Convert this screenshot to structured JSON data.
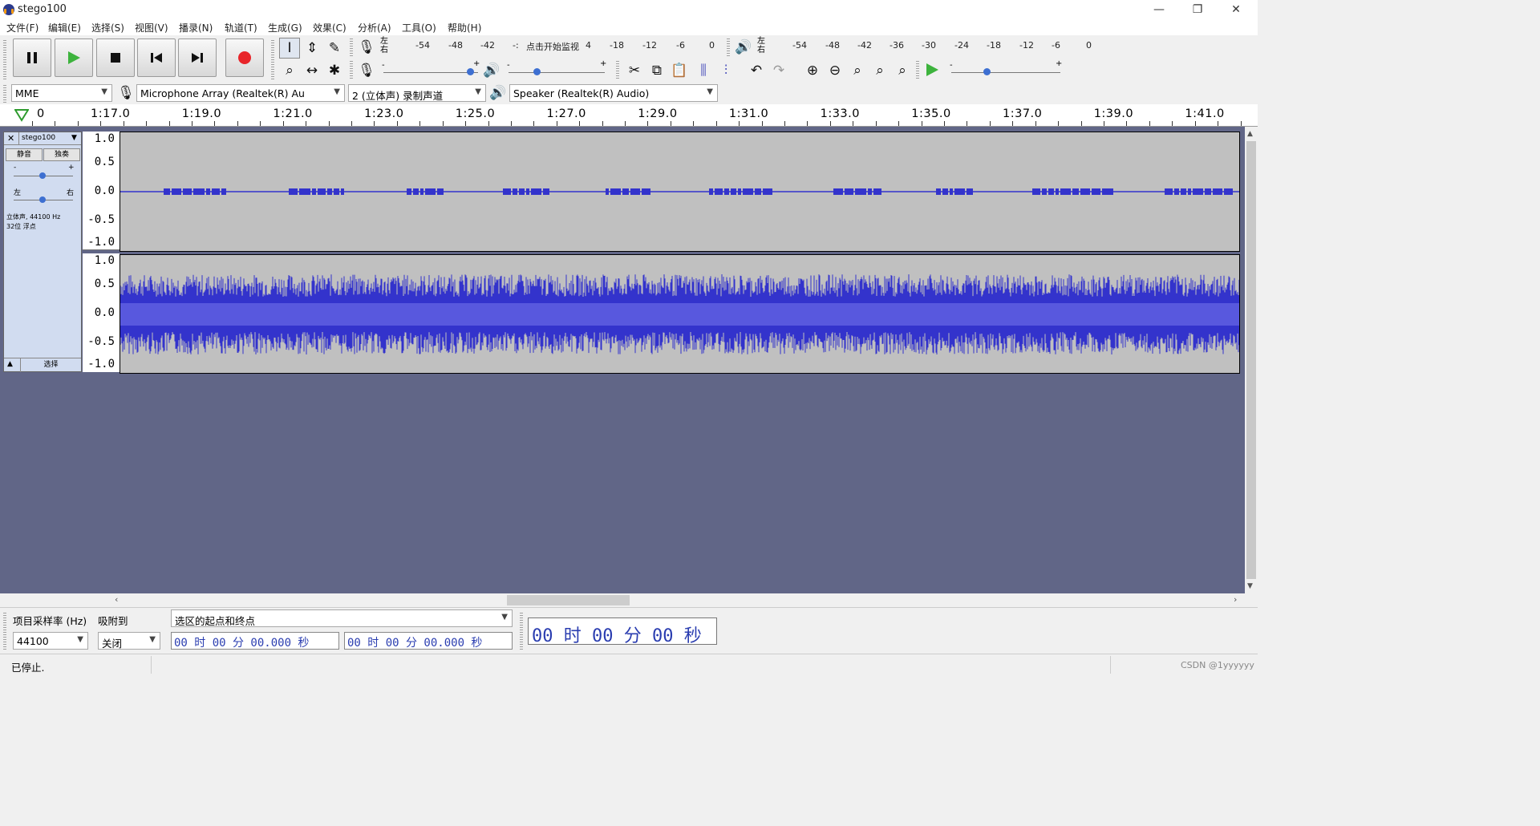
{
  "window": {
    "title": "stego100",
    "minimize": "—",
    "restore": "❐",
    "close": "✕"
  },
  "menu": [
    "文件(F)",
    "编辑(E)",
    "选择(S)",
    "视图(V)",
    "播录(N)",
    "轨道(T)",
    "生成(G)",
    "效果(C)",
    "分析(A)",
    "工具(O)",
    "帮助(H)"
  ],
  "transport": {
    "pause": "pause-icon",
    "play": "play-icon",
    "stop": "stop-icon",
    "skip_start": "skip-start-icon",
    "skip_end": "skip-end-icon",
    "record": "record-icon",
    "record_color": "#e8252a",
    "play_color": "#3db33d"
  },
  "recording_meter": {
    "lr": [
      "左",
      "右"
    ],
    "ticks": [
      "-54",
      "-48",
      "-42",
      "-:",
      "点击开始监视",
      "4",
      "-18",
      "-12",
      "-6",
      "0"
    ]
  },
  "playback_meter": {
    "lr": [
      "左",
      "右"
    ],
    "ticks": [
      "-54",
      "-48",
      "-42",
      "-36",
      "-30",
      "-24",
      "-18",
      "-12",
      "-6",
      "0"
    ]
  },
  "sliders": {
    "minus": "-",
    "plus": "+"
  },
  "devices": {
    "host": "MME",
    "input": "Microphone Array (Realtek(R) Au",
    "channels": "2 (立体声) 录制声道",
    "output": "Speaker (Realtek(R) Audio)"
  },
  "timeline": {
    "start_label": "0",
    "labels": [
      "1:17.0",
      "1:19.0",
      "1:21.0",
      "1:23.0",
      "1:25.0",
      "1:27.0",
      "1:29.0",
      "1:31.0",
      "1:33.0",
      "1:35.0",
      "1:37.0",
      "1:39.0",
      "1:41.0"
    ]
  },
  "track": {
    "name": "stego100",
    "close": "✕",
    "mute": "静音",
    "solo": "独奏",
    "gain_minus": "-",
    "gain_plus": "+",
    "pan_left": "左",
    "pan_right": "右",
    "info_line1": "立体声, 44100 Hz",
    "info_line2": "32位 浮点",
    "select": "选择",
    "ruler_labels": [
      "1.0",
      "0.5",
      "0.0",
      "-0.5",
      "-1.0"
    ],
    "wave_color": "#3333cc"
  },
  "selection_toolbar": {
    "rate_label": "项目采样率 (Hz)",
    "snap_label": "吸附到",
    "rate_value": "44100",
    "snap_value": "关闭",
    "mode": "选区的起点和终点",
    "start_time": "00 时 00 分 00.000 秒",
    "end_time": "00 时 00 分 00.000 秒",
    "audio_position": "00 时 00 分 00 秒"
  },
  "status": {
    "text": "已停止.",
    "watermark": "CSDN @1yyyyyy"
  }
}
